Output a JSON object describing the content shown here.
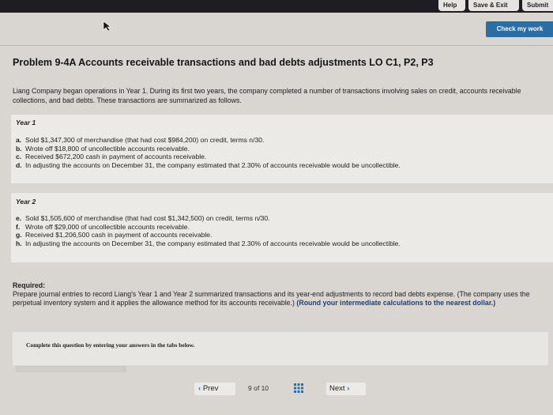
{
  "topbar": {
    "help": "Help",
    "save_exit": "Save & Exit",
    "submit": "Submit"
  },
  "check_work": "Check my work",
  "title": "Problem 9-4A Accounts receivable transactions and bad debts adjustments LO C1, P2, P3",
  "intro": "Liang Company began operations in Year 1. During its first two years, the company completed a number of transactions involving sales on credit, accounts receivable collections, and bad debts. These transactions are summarized as follows.",
  "year1": {
    "heading": "Year 1",
    "items": [
      {
        "letter": "a.",
        "text": "Sold $1,347,300 of merchandise (that had cost $984,200) on credit, terms n/30."
      },
      {
        "letter": "b.",
        "text": "Wrote off $18,800 of uncollectible accounts receivable."
      },
      {
        "letter": "c.",
        "text": "Received $672,200 cash in payment of accounts receivable."
      },
      {
        "letter": "d.",
        "text": "In adjusting the accounts on December 31, the company estimated that 2.30% of accounts receivable would be uncollectible."
      }
    ]
  },
  "year2": {
    "heading": "Year 2",
    "items": [
      {
        "letter": "e.",
        "text": "Sold $1,505,600 of merchandise (that had cost $1,342,500) on credit, terms n/30."
      },
      {
        "letter": "f.",
        "text": "Wrote off $29,000 of uncollectible accounts receivable."
      },
      {
        "letter": "g.",
        "text": "Received $1,206,500 cash in payment of accounts receivable."
      },
      {
        "letter": "h.",
        "text": "In adjusting the accounts on December 31, the company estimated that 2.30% of accounts receivable would be uncollectible."
      }
    ]
  },
  "required": {
    "heading": "Required:",
    "text": "Prepare journal entries to record Liang's Year 1 and Year 2 summarized transactions and its year-end adjustments to record bad debts expense. (The company uses the perpetual inventory system and it applies the allowance method for its accounts receivable.)",
    "bold": "(Round your intermediate calculations to the nearest dollar.)"
  },
  "instructions": "Complete this question by entering your answers in the tabs below.",
  "nav": {
    "prev": "Prev",
    "page": "9",
    "of": "of",
    "total": "10",
    "next": "Next"
  },
  "colors": {
    "accent": "#2a6ea8",
    "topbar": "#1e1e22"
  }
}
